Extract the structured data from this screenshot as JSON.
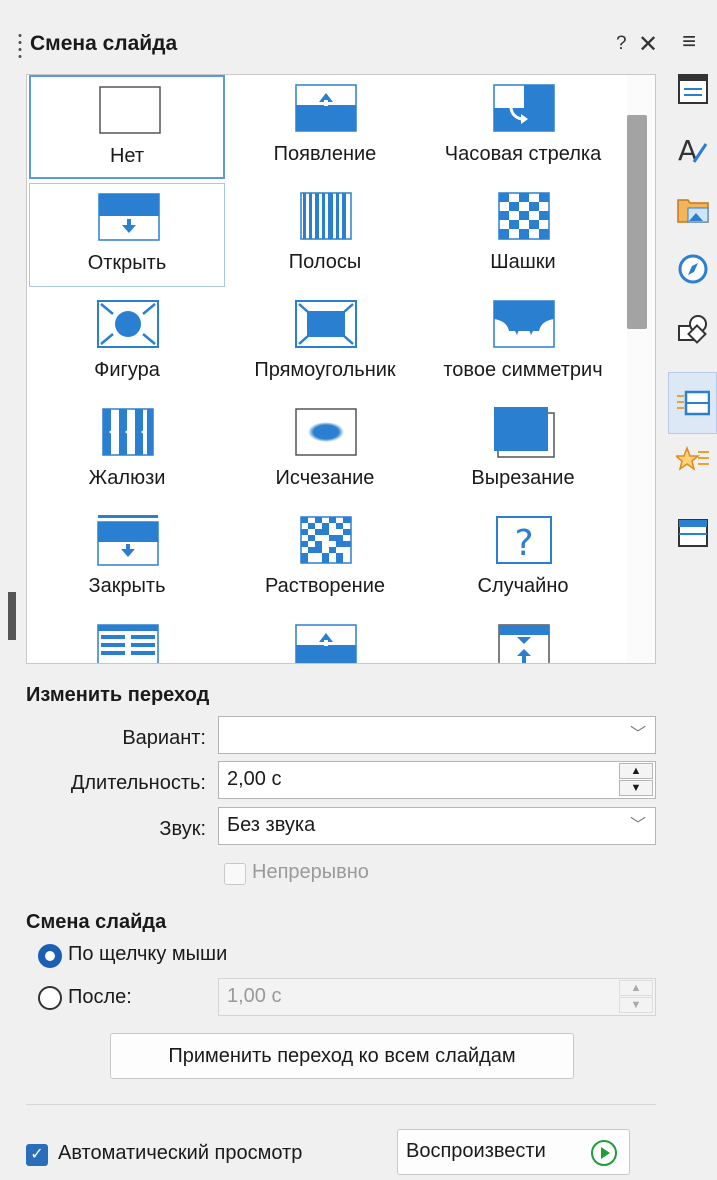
{
  "panel": {
    "title": "Смена слайда",
    "help": "?",
    "close": "✕",
    "menu": "≡"
  },
  "transitions": [
    {
      "label": "Нет",
      "icon": "none-icon"
    },
    {
      "label": "Появление",
      "icon": "appear-icon"
    },
    {
      "label": "Часовая стрелка",
      "icon": "clockwise-icon"
    },
    {
      "label": "Открыть",
      "icon": "open-icon"
    },
    {
      "label": "Полосы",
      "icon": "bars-icon"
    },
    {
      "label": "Шашки",
      "icon": "checkers-icon"
    },
    {
      "label": "Фигура",
      "icon": "shape-icon"
    },
    {
      "label": "Прямоугольник",
      "icon": "box-icon"
    },
    {
      "label": "товое симметрич",
      "icon": "wedge-icon"
    },
    {
      "label": "Жалюзи",
      "icon": "venetian-icon"
    },
    {
      "label": "Исчезание",
      "icon": "fade-icon"
    },
    {
      "label": "Вырезание",
      "icon": "cut-icon"
    },
    {
      "label": "Закрыть",
      "icon": "close-transition-icon"
    },
    {
      "label": "Растворение",
      "icon": "dissolve-icon"
    },
    {
      "label": "Случайно",
      "icon": "random-icon"
    },
    {
      "label": "",
      "icon": "lines-icon"
    },
    {
      "label": "",
      "icon": "appear-icon"
    },
    {
      "label": "",
      "icon": "compress-icon"
    }
  ],
  "modify": {
    "heading": "Изменить переход",
    "variant_label": "Вариант:",
    "variant_value": "",
    "duration_label": "Длительность:",
    "duration_value": "2,00 с",
    "sound_label": "Звук:",
    "sound_value": "Без звука",
    "loop_label": "Непрерывно"
  },
  "advance": {
    "heading": "Смена слайда",
    "on_click_label": "По щелчку мыши",
    "after_label": "После:",
    "after_value": "1,00 с",
    "apply_all_label": "Применить переход ко всем слайдам"
  },
  "footer": {
    "auto_preview_label": "Автоматический просмотр",
    "play_label": "Воспроизвести"
  },
  "colors": {
    "accent": "#2b7fd0",
    "selection_border": "#5b9bd5"
  }
}
